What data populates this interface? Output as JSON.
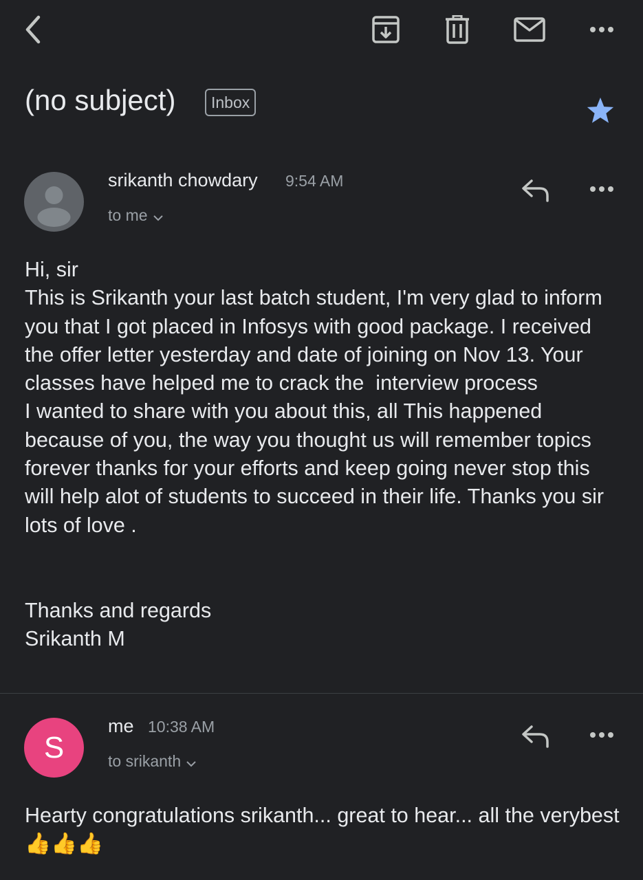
{
  "toolbar": {
    "back_icon": "back-arrow-icon",
    "archive_icon": "archive-icon",
    "delete_icon": "trash-icon",
    "mark_unread_icon": "mail-icon",
    "more_icon": "more-horizontal-icon"
  },
  "thread": {
    "subject": "(no subject)",
    "label": "Inbox",
    "starred": true,
    "star_color": "#8ab4f8"
  },
  "messages": [
    {
      "sender": "srikanth chowdary",
      "time": "9:54 AM",
      "recipient": "to me",
      "avatar_initial": "",
      "paragraphs": [
        "Hi, sir",
        "This is Srikanth your last batch student, I'm very glad to inform you that I got placed in Infosys with good package. I received the offer letter yesterday and date of joining on Nov 13. Your classes have helped me to crack the  interview process",
        "I wanted to share with you about this, all This happened because of you, the way you thought us will remember topics  forever thanks for your efforts and keep going never stop this will help alot of students to succeed in their life. Thanks you sir lots of love .",
        " ",
        " ",
        "Thanks and regards",
        "Srikanth M"
      ]
    },
    {
      "sender": "me",
      "time": "10:38 AM",
      "recipient": "to srikanth",
      "avatar_initial": "S",
      "avatar_color": "#e8437f",
      "paragraphs": [
        "Hearty congratulations srikanth... great to hear... all the verybest 👍👍👍"
      ]
    }
  ]
}
